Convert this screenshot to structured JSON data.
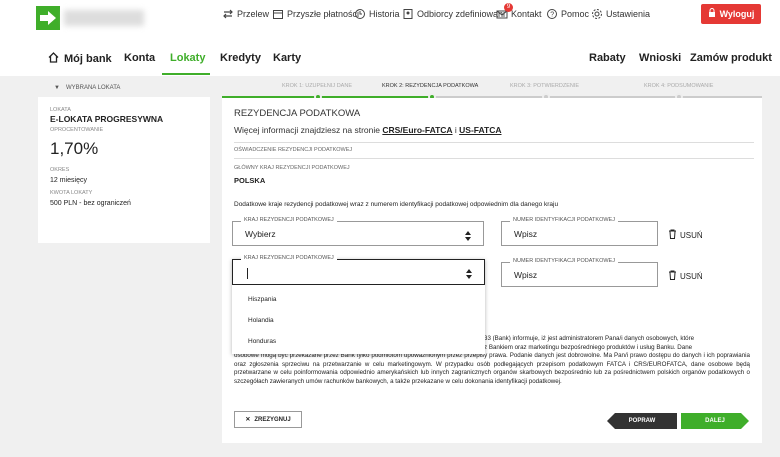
{
  "header": {
    "util": [
      "Przelew",
      "Przyszłe płatności",
      "Historia",
      "Odbiorcy zdefiniowani",
      "Kontakt",
      "Pomoc",
      "Ustawienia"
    ],
    "kontakt_badge": "9",
    "logout": "Wyloguj"
  },
  "nav": {
    "left": [
      "Mój bank",
      "Konta",
      "Lokaty",
      "Kredyty",
      "Karty"
    ],
    "right": [
      "Rabaty",
      "Wnioski",
      "Zamów produkt"
    ]
  },
  "sidebar": {
    "head": "WYBRANA LOKATA",
    "lokata_label": "LOKATA",
    "lokata": "E-LOKATA PROGRESYWNA",
    "rate_label": "OPROCENTOWANIE",
    "rate": "1,70%",
    "period_label": "OKRES",
    "period": "12 miesięcy",
    "amount_label": "KWOTA LOKATY",
    "amount": "500 PLN - bez ograniczeń"
  },
  "steps": [
    "KROK 1: UZUPEŁNIJ DANE",
    "KROK 2: REZYDENCJA PODATKOWA",
    "KROK 3: POTWIERDZENIE",
    "KROK 4: PODSUMOWANIE"
  ],
  "main": {
    "title": "REZYDENCJA PODATKOWA",
    "info_prefix": "Więcej informacji znajdziesz na stronie ",
    "link1": "CRS/Euro-FATCA",
    "info_and": " i ",
    "link2": "US-FATCA",
    "decl_label": "OŚWIADCZENIE REZYDENCJI PODATKOWEJ",
    "main_country_label": "GŁÓWNY KRAJ REZYDENCJI PODATKOWEJ",
    "main_country": "POLSKA",
    "desc": "Dodatkowe kraje rezydencji podatkowej wraz z numerem identyfikacji podatkowej odpowiednim dla danego kraju",
    "country_label": "KRAJ REZYDENCJI PODATKOWEJ",
    "country1": "Wybierz",
    "country2": "",
    "tin_label": "NUMER IDENTYFIKACJI PODATKOWEJ",
    "tin_placeholder": "Wpisz",
    "remove": "USUŃ",
    "options": [
      "Hiszpania",
      "Holandia",
      "Honduras"
    ],
    "legal_1": "33 (Bank) informuje, iż jest administratorem Pana/i danych osobowych, które",
    "legal_2": "z Bankiem oraz marketingu bezpośredniego produktów i usług Banku. Dane",
    "legal_3": "osobowe mogą być przekazane przez Bank tylko podmiotom upoważnionym przez przepisy prawa. Podanie danych jest dobrowolne. Ma Pan/i prawo dostępu do danych i ich poprawiania oraz zgłoszenia sprzeciwu na przetwarzanie w celu marketingowym. W przypadku osób podlegających przepisom podatkowym FATCA i CRS/EUROFATCA, dane osobowe będą przetwarzane w celu poinformowania odpowiednio amerykańskich lub innych zagranicznych organów skarbowych bezpośrednio lub za pośrednictwem polskich organów podatkowych o szczegółach zawieranych umów rachunków bankowych, a także przekazane w celu dokonania identyfikacji podatkowej.",
    "cancel": "ZREZYGNUJ",
    "back": "POPRAW",
    "next": "DALEJ"
  },
  "colors": {
    "accent": "#3fae2a",
    "danger": "#e53935",
    "dark": "#333333"
  }
}
